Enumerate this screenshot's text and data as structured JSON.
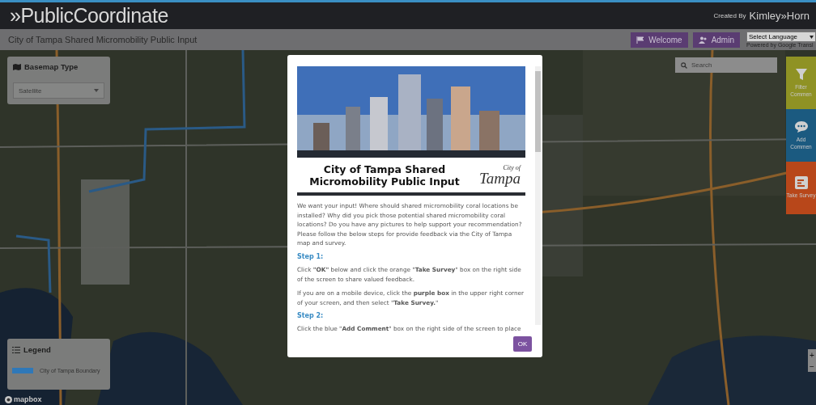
{
  "header": {
    "brand": "»PublicCoordinate",
    "credit_prefix": "Created By",
    "credit_brand": "Kimley»Horn"
  },
  "subheader": {
    "title": "City of Tampa Shared Micromobility Public Input",
    "buttons": [
      {
        "label": "Welcome",
        "kind": "welcome"
      },
      {
        "label": "Admin",
        "kind": "admin"
      }
    ],
    "language": {
      "value": "Select Language",
      "powered": "Powered by Google Transl"
    }
  },
  "basemap_panel": {
    "title": "Basemap Type",
    "value": "Satellite"
  },
  "legend": {
    "title": "Legend",
    "items": [
      {
        "label": "City of Tampa Boundary",
        "color": "#2f78b8"
      }
    ]
  },
  "search": {
    "placeholder": "Search"
  },
  "side_buttons": [
    {
      "label": "Filter Commen",
      "kind": "filter",
      "color": "#8f9224"
    },
    {
      "label": "Add Commen",
      "kind": "comment",
      "color": "#1b5a80"
    },
    {
      "label": "Take Survey",
      "kind": "survey",
      "color": "#b8471a"
    }
  ],
  "zoom_controls": [
    "+",
    "−"
  ],
  "mapbox": "mapbox",
  "modal": {
    "banner_title": "City of Tampa Shared Micromobility Public Input",
    "logo_small": "City of",
    "logo": "Tampa",
    "paragraphs": [
      {
        "kind": "text",
        "text": "We want your input! Where should shared micromobility coral locations be installed? Why did you pick those potential shared micromobility coral locations? Do you have any pictures to help support your recommendation? Please follow the below steps for provide feedback via the City of Tampa map and survey."
      },
      {
        "kind": "step",
        "text": "Step 1:"
      },
      {
        "kind": "text",
        "text": "Click **\"OK\"** below and click the orange \"**Take Survey**\" box on the right side of the screen to share valued feedback."
      },
      {
        "kind": "highlight",
        "text": "If you are on a mobile device, click the **purple box** in the upper right corner of your screen, and then select \"**Take Survey.**\""
      },
      {
        "kind": "step",
        "text": "Step 2:"
      },
      {
        "kind": "text",
        "text": "Click the blue \"**Add Comment**\" box on the right side of the screen to place"
      }
    ],
    "ok": "OK"
  }
}
